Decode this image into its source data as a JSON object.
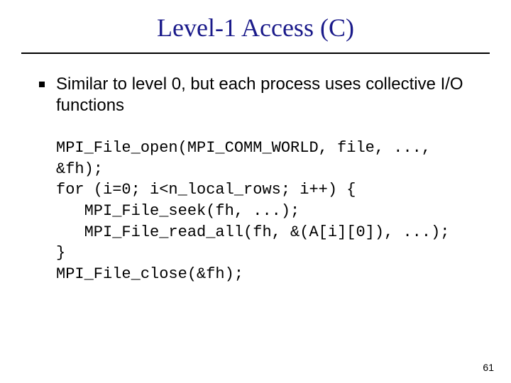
{
  "title": "Level-1 Access (C)",
  "bullet_text": "Similar to level 0, but each process uses collective I/O functions",
  "code_lines": [
    "MPI_File_open(MPI_COMM_WORLD, file, ...,",
    "&fh);",
    "for (i=0; i<n_local_rows; i++) {",
    "   MPI_File_seek(fh, ...);",
    "   MPI_File_read_all(fh, &(A[i][0]), ...);",
    "}",
    "MPI_File_close(&fh);"
  ],
  "page_number": "61"
}
